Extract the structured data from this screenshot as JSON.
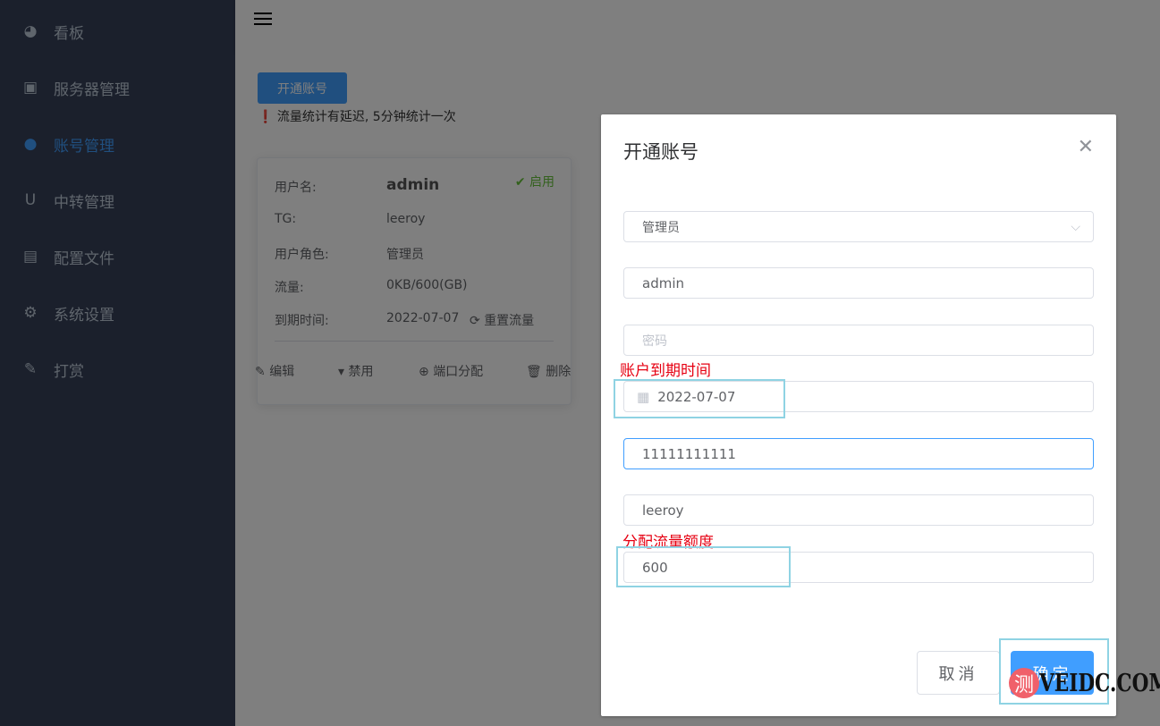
{
  "sidebar": {
    "items": [
      {
        "label": "看板",
        "icon": "dashboard-icon"
      },
      {
        "label": "服务器管理",
        "icon": "chip-icon"
      },
      {
        "label": "账号管理",
        "icon": "user-icon",
        "active": true
      },
      {
        "label": "中转管理",
        "icon": "magnet-icon"
      },
      {
        "label": "配置文件",
        "icon": "document-icon"
      },
      {
        "label": "系统设置",
        "icon": "gear-icon"
      },
      {
        "label": "打赏",
        "icon": "candy-icon"
      }
    ]
  },
  "main": {
    "open_button": "开通账号",
    "notice": "流量统计有延迟, 5分钟统计一次",
    "card": {
      "username_label": "用户名:",
      "username": "admin",
      "status": "启用",
      "tg_label": "TG:",
      "tg": "leeroy",
      "role_label": "用户角色:",
      "role": "管理员",
      "traffic_label": "流量:",
      "traffic": "0KB/600(GB)",
      "expiry_label": "到期时间:",
      "expiry": "2022-07-07",
      "reset": "重置流量",
      "edit": "编辑",
      "disable": "禁用",
      "ports": "端口分配",
      "delete": "删除"
    }
  },
  "dialog": {
    "title": "开通账号",
    "role": "管理员",
    "username": "admin",
    "password_placeholder": "密码",
    "expiry": "2022-07-07",
    "phone": "11111111111",
    "tg": "leeroy",
    "traffic": "600",
    "cancel": "取消",
    "confirm": "确定"
  },
  "annotations": {
    "expiry": "账户到期时间",
    "traffic": "分配流量额度"
  },
  "watermark": {
    "badge": "测",
    "text": "VEIDC.COM"
  }
}
